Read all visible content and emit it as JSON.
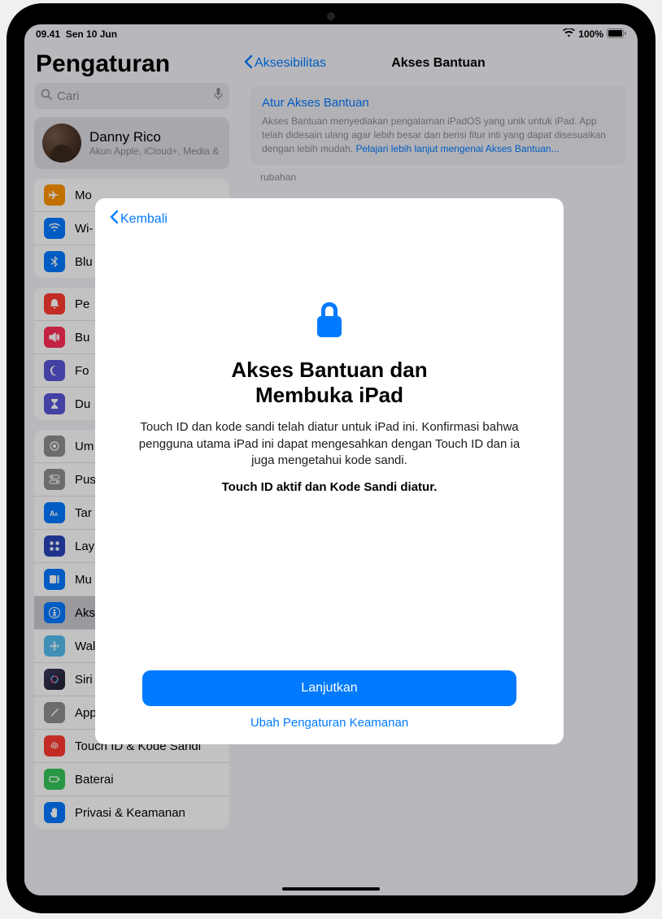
{
  "status": {
    "time": "09.41",
    "date": "Sen 10 Jun",
    "battery": "100%"
  },
  "sidebar": {
    "title": "Pengaturan",
    "search_placeholder": "Cari",
    "profile": {
      "name": "Danny Rico",
      "sub": "Akun Apple, iCloud+, Media &"
    },
    "g1": {
      "i0": "Mo",
      "i1": "Wi-",
      "i2": "Blu"
    },
    "g2": {
      "i0": "Pe",
      "i1": "Bu",
      "i2": "Fo",
      "i3": "Du"
    },
    "g3": {
      "i0": "Um",
      "i1": "Pus",
      "i2": "Tar",
      "i3": "Lay",
      "i4": "Mu",
      "i5": "Aks",
      "i6": "Wallpaper",
      "i7": "Siri & Cari",
      "i8": "Apple Pencil",
      "i9": "Touch ID & Kode Sandi",
      "i10": "Baterai",
      "i11": "Privasi & Keamanan"
    }
  },
  "detail": {
    "back": "Aksesibilitas",
    "title": "Akses Bantuan",
    "box_title": "Atur Akses Bantuan",
    "box_desc": "Akses Bantuan menyediakan pengalaman iPadOS yang unik untuk iPad. App telah didesain ulang agar lebih besar dan berisi fitur inti yang dapat disesuaikan dengan lebih mudah. ",
    "box_link": "Pelajari lebih lanjut mengenai Akses Bantuan...",
    "extra": "rubahan"
  },
  "modal": {
    "back": "Kembali",
    "title_l1": "Akses Bantuan dan",
    "title_l2": "Membuka iPad",
    "body": "Touch ID dan kode sandi telah diatur untuk iPad ini. Konfirmasi bahwa pengguna utama iPad ini dapat mengesahkan dengan Touch ID dan ia juga mengetahui kode sandi.",
    "bold": "Touch ID aktif dan Kode Sandi diatur.",
    "primary": "Lanjutkan",
    "secondary": "Ubah Pengaturan Keamanan"
  },
  "colors": {
    "airplane": "#ff9500",
    "wifi": "#007aff",
    "bt": "#007aff",
    "notif": "#ff3b30",
    "sound": "#ff2d55",
    "focus": "#5856d6",
    "screentime": "#5856d6",
    "general": "#8e8e93",
    "cc": "#8e8e93",
    "display": "#007aff",
    "home": "#2845b8",
    "multi": "#007aff",
    "access": "#007aff",
    "wall": "#55bef0",
    "siri": "#1e1e2e",
    "pencil": "#8e8e93",
    "touch": "#ff3b30",
    "batt": "#34c759",
    "priv": "#007aff"
  }
}
